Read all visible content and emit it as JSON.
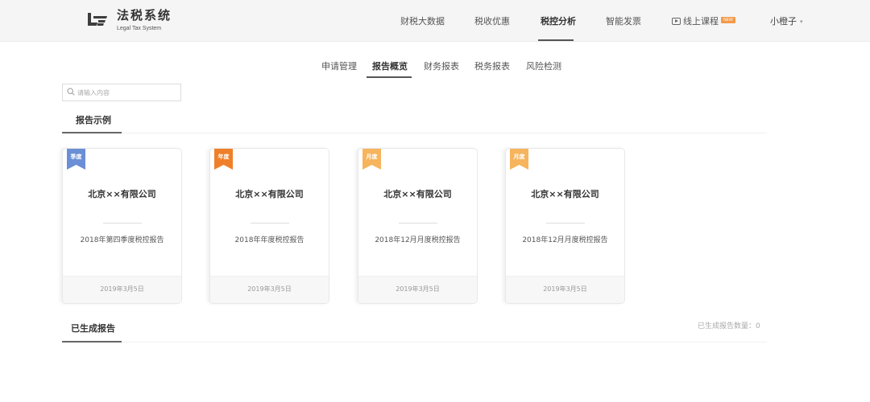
{
  "brand": {
    "title": "法税系统",
    "subtitle": "Legal Tax System"
  },
  "nav": {
    "items": [
      {
        "label": "财税大数据"
      },
      {
        "label": "税收优惠"
      },
      {
        "label": "税控分析"
      },
      {
        "label": "智能发票"
      },
      {
        "label": "线上课程"
      }
    ],
    "active_index": 2,
    "new_badge": "NEW",
    "user_name": "小橙子"
  },
  "subtabs": {
    "items": [
      {
        "label": "申请管理"
      },
      {
        "label": "报告概览"
      },
      {
        "label": "财务报表"
      },
      {
        "label": "税务报表"
      },
      {
        "label": "风险检测"
      }
    ],
    "active_index": 1
  },
  "search": {
    "placeholder": "请输入内容",
    "value": ""
  },
  "sections": {
    "examples_title": "报告示例",
    "generated_title": "已生成报告",
    "generated_count_label": "已生成报告数量：0"
  },
  "cards": [
    {
      "tag": "季度",
      "tag_color": "#6b8fd6",
      "company": "北京××有限公司",
      "report": "2018年第四季度税控报告",
      "date": "2019年3月5日"
    },
    {
      "tag": "年度",
      "tag_color": "#f07f2a",
      "company": "北京××有限公司",
      "report": "2018年年度税控报告",
      "date": "2019年3月5日"
    },
    {
      "tag": "月度",
      "tag_color": "#f6b45c",
      "company": "北京××有限公司",
      "report": "2018年12月月度税控报告",
      "date": "2019年3月5日"
    },
    {
      "tag": "月度",
      "tag_color": "#f6b45c",
      "company": "北京××有限公司",
      "report": "2018年12月月度税控报告",
      "date": "2019年3月5日"
    }
  ],
  "colors": {
    "topbar_bg": "#f5f5f5",
    "accent_dark": "#555555",
    "new_badge": "#f29a4a"
  },
  "icons": {
    "logo": "brand-logo-icon",
    "search": "search-icon",
    "course": "play-icon",
    "user_caret": "chevron-down-icon",
    "card_tag": "bookmark-ribbon-icon"
  }
}
